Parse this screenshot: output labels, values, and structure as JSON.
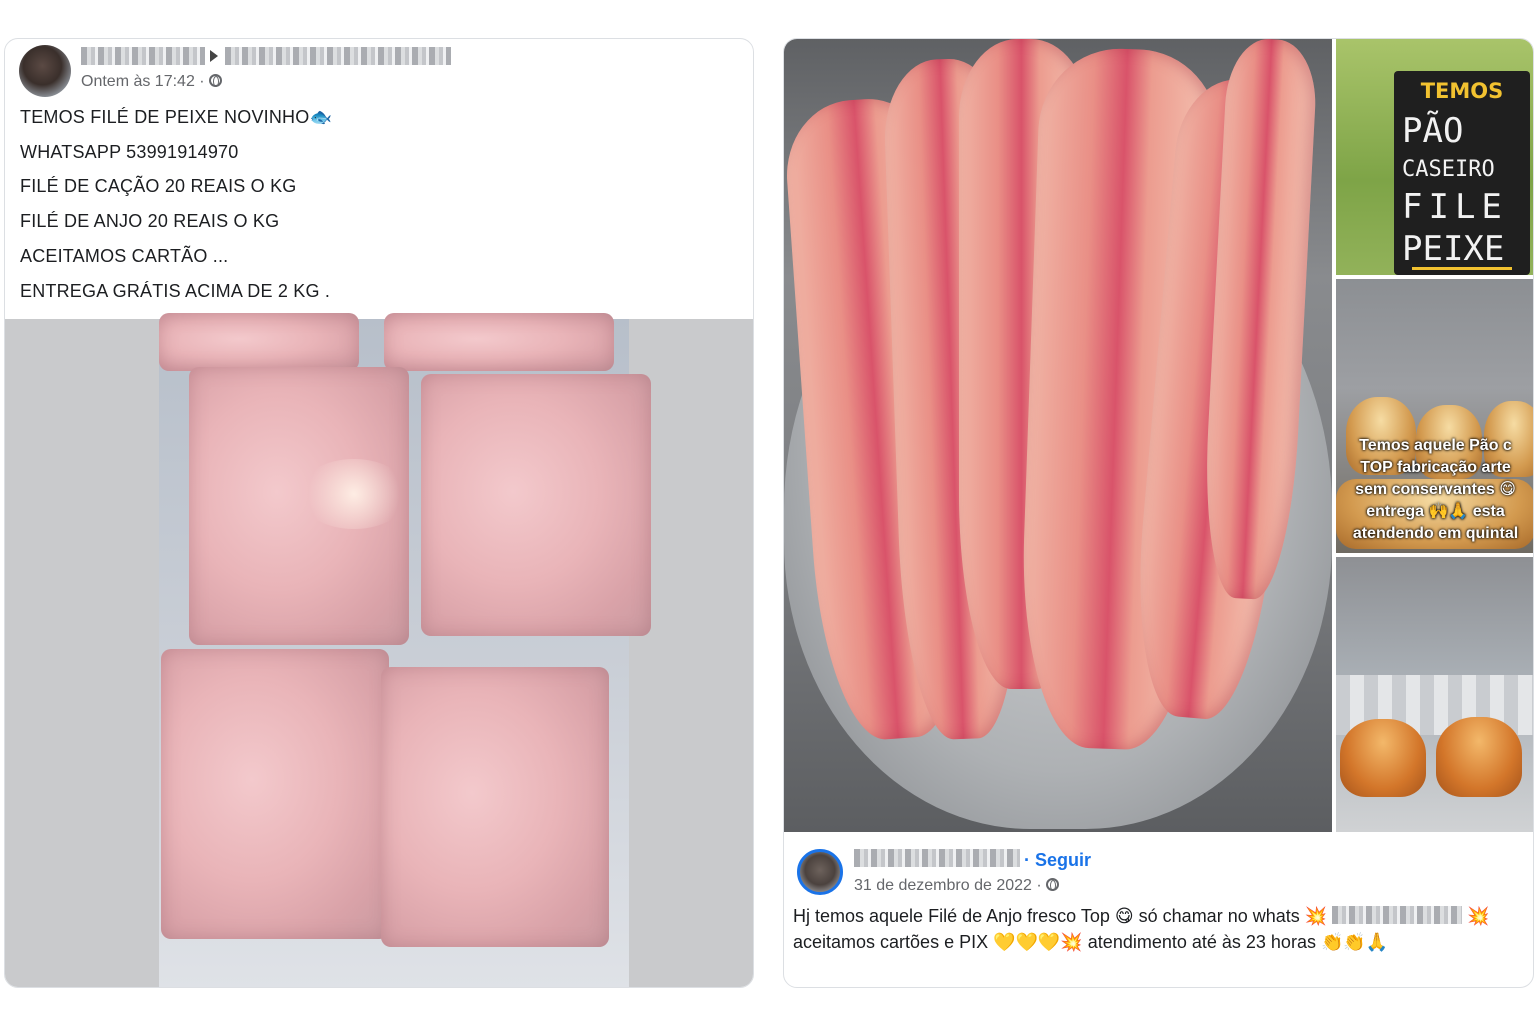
{
  "left_post": {
    "timestamp": "Ontem às 17:42 ·",
    "lines": [
      "TEMOS FILÉ DE PEIXE NOVINHO",
      "WHATSAPP 53991914970",
      "FILÉ DE CAÇÃO 20 REAIS O KG",
      "FILÉ DE ANJO 20 REAIS O KG",
      "ACEITAMOS CARTÃO ...",
      "ENTREGA GRÁTIS ACIMA DE 2 KG ."
    ],
    "fish_emoji": "🐟"
  },
  "right_post": {
    "sign": {
      "temos": "TEMOS",
      "line1": "PÃO",
      "line2": "CASEIRO",
      "line3": "FILE",
      "line4": "PEIXE"
    },
    "bread_caption": [
      "Temos aquele Pão c",
      "TOP fabricação arte",
      "sem conservantes 😋",
      "entrega 🙌🙏 esta",
      "atendendo em quintal"
    ],
    "follow_label": "· Seguir",
    "date": "31 de dezembro de 2022 ·",
    "caption_line1_a": "Hj temos aquele Filé de Anjo fresco Top",
    "caption_line1_b": "só chamar no whats",
    "caption_line2_a": "aceitamos cartões e PIX",
    "caption_line2_b": "atendimento até às 23 horas",
    "emoji_yum": "😋",
    "emoji_burst": "💥",
    "emoji_hearts": "💛💛💛",
    "emoji_clap": "👏👏🙏"
  },
  "colors": {
    "link_blue": "#1a73e8",
    "meta_gray": "#65676b",
    "border": "#dcdfe3"
  }
}
